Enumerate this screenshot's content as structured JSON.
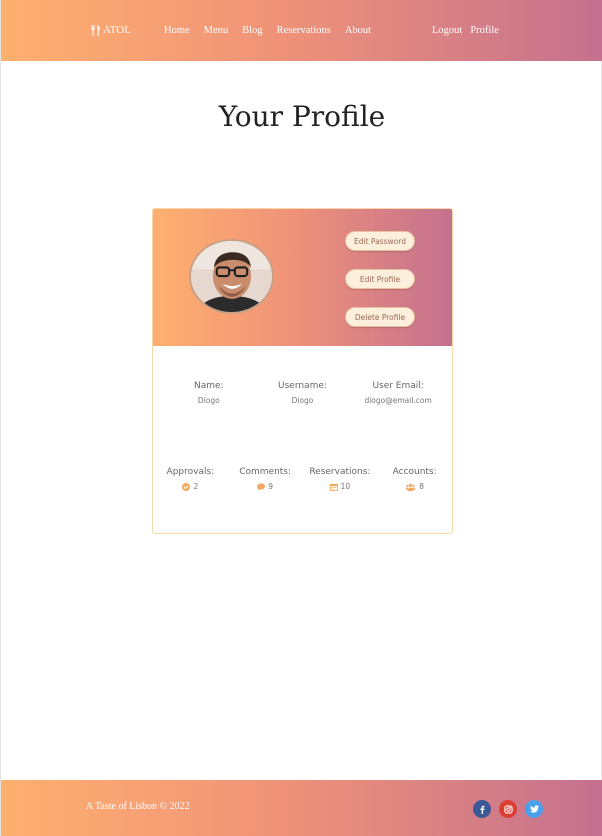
{
  "header": {
    "brand": "ATOL",
    "nav": [
      "Home",
      "Menu",
      "Blog",
      "Reservations",
      "About"
    ],
    "right_nav": [
      "Logout",
      "Profile"
    ]
  },
  "page_title": "Your Profile",
  "profile": {
    "buttons": {
      "edit_password": "Edit Password",
      "edit_profile": "Edit Profile",
      "delete_profile": "Delete Profile"
    },
    "fields": {
      "name_label": "Name:",
      "name_value": "Diogo",
      "username_label": "Username:",
      "username_value": "Diogo",
      "email_label": "User Email:",
      "email_value": "diogo@email.com"
    },
    "stats": {
      "approvals_label": "Approvals:",
      "approvals_value": "2",
      "comments_label": "Comments:",
      "comments_value": "9",
      "reservations_label": "Reservations:",
      "reservations_value": "10",
      "accounts_label": "Accounts:",
      "accounts_value": "8"
    }
  },
  "footer": {
    "copyright": "A Taste of Lisbon © 2022",
    "socials": [
      "facebook-icon",
      "instagram-icon",
      "twitter-icon"
    ]
  },
  "colors": {
    "gradient_start": "#ffb06f",
    "gradient_end": "#c4718f",
    "accent": "#f3a861",
    "facebook": "#3b5998",
    "instagram": "#dd3e33",
    "twitter": "#4aa1eb"
  }
}
